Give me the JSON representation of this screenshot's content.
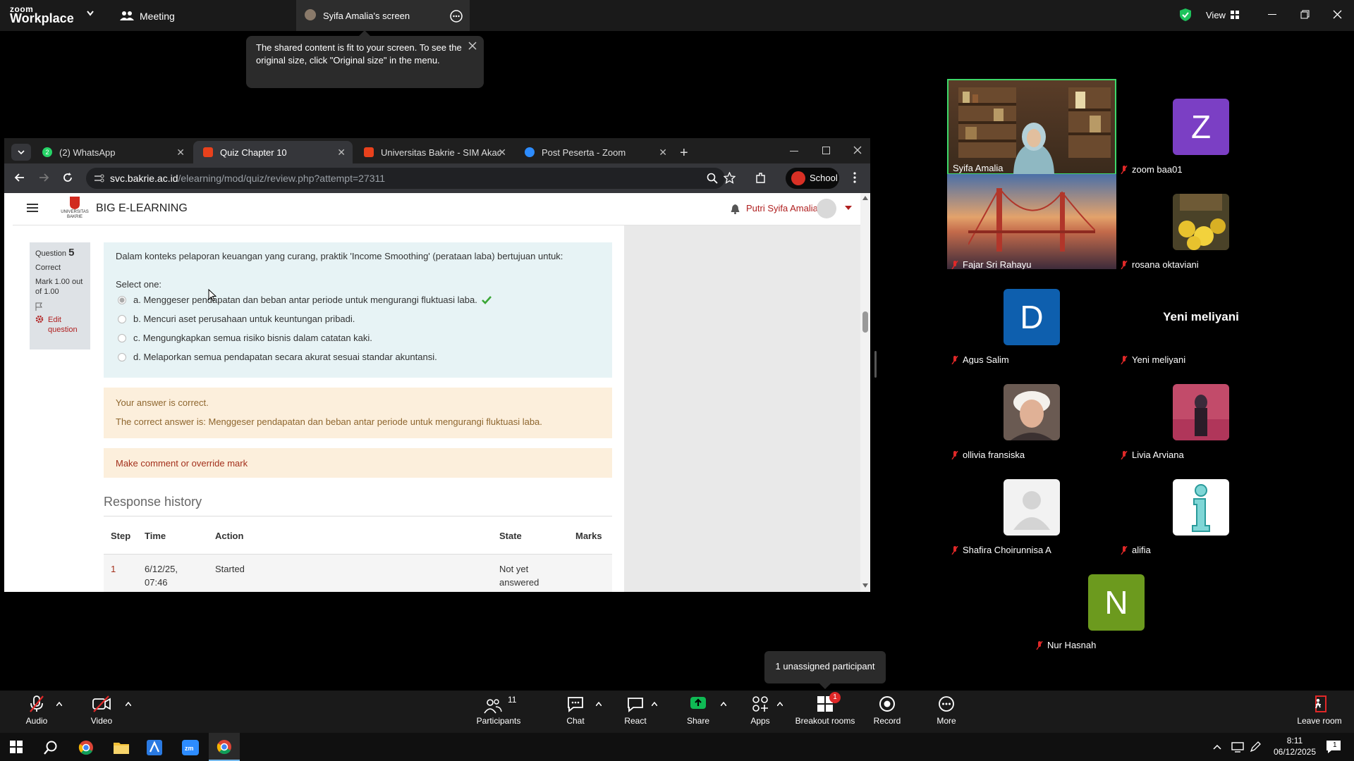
{
  "zoom": {
    "logo_line1": "zoom",
    "logo_line2": "Workplace",
    "meeting_label": "Meeting",
    "share_title": "Syifa Amalia's screen",
    "view_label": "View"
  },
  "tooltip": {
    "text": "The shared content is fit to your screen. To see the original size, click \"Original size\" in the menu."
  },
  "browser": {
    "tabs": [
      {
        "label": "(2) WhatsApp",
        "badge": "2"
      },
      {
        "label": "Quiz Chapter 10"
      },
      {
        "label": "Universitas Bakrie - SIM Akade"
      },
      {
        "label": "Post Peserta - Zoom"
      }
    ],
    "url_host": "svc.bakrie.ac.id",
    "url_path": "/elearning/mod/quiz/review.php?attempt=27311",
    "profile_label": "School"
  },
  "moodle": {
    "site_title": "BIG E-LEARNING",
    "logo_text": "UNIVERSITAS BAKRIE",
    "user_name": "Putri Syifa Amalia",
    "question": {
      "label": "Question",
      "number": "5",
      "status": "Correct",
      "mark": "Mark 1.00 out of 1.00",
      "edit": "Edit question",
      "text": "Dalam konteks pelaporan keuangan yang curang, praktik 'Income Smoothing' (perataan laba) bertujuan untuk:",
      "select_one": "Select one:",
      "options": [
        "a. Menggeser pendapatan dan beban antar periode untuk mengurangi fluktuasi laba.",
        "b. Mencuri aset perusahaan untuk keuntungan pribadi.",
        "c. Mengungkapkan semua risiko bisnis dalam catatan kaki.",
        "d. Melaporkan semua pendapatan secara akurat sesuai standar akuntansi."
      ],
      "selected_index": 0
    },
    "feedback": {
      "correct": "Your answer is correct.",
      "answer": "The correct answer is: Menggeser pendapatan dan beban antar periode untuk mengurangi fluktuasi laba."
    },
    "comment_link": "Make comment or override mark",
    "history": {
      "title": "Response history",
      "headers": [
        "Step",
        "Time",
        "Action",
        "State",
        "Marks"
      ],
      "rows": [
        {
          "step": "1",
          "time_line1": "6/12/25,",
          "time_line2": "07:46",
          "action": "Started",
          "state_line1": "Not yet",
          "state_line2": "answered",
          "marks": ""
        }
      ]
    }
  },
  "participants": [
    {
      "name": "Syifa Amalia",
      "type": "video",
      "muted": false,
      "active": true
    },
    {
      "name": "zoom baa01",
      "type": "letter",
      "letter": "Z",
      "color": "#7b3fc4",
      "muted": true
    },
    {
      "name": "Fajar Sri Rahayu",
      "type": "image-bridge",
      "muted": true
    },
    {
      "name": "rosana oktaviani",
      "type": "image-flowers",
      "muted": true
    },
    {
      "name": "Agus Salim",
      "type": "letter",
      "letter": "D",
      "color": "#0e5fae",
      "muted": true
    },
    {
      "name": "Yeni meliyani",
      "type": "name-only",
      "muted": true
    },
    {
      "name": "ollivia fransiska",
      "type": "photo",
      "muted": true
    },
    {
      "name": "Livia Arviana",
      "type": "photo2",
      "muted": true
    },
    {
      "name": "Shafira Choirunnisa A",
      "type": "default",
      "muted": true
    },
    {
      "name": "alifia",
      "type": "info",
      "muted": true
    },
    {
      "name": "Nur Hasnah",
      "type": "letter",
      "letter": "N",
      "color": "#6c9a1e",
      "muted": true
    }
  ],
  "unassigned_note": "1 unassigned participant",
  "toolbar": {
    "audio": "Audio",
    "video": "Video",
    "participants": "Participants",
    "participants_count": "11",
    "chat": "Chat",
    "react": "React",
    "share": "Share",
    "apps": "Apps",
    "breakout": "Breakout rooms",
    "breakout_badge": "1",
    "record": "Record",
    "more": "More",
    "leave": "Leave room"
  },
  "taskbar": {
    "time": "8:11",
    "date": "06/12/2025",
    "notif_count": "1"
  },
  "colors": {
    "zoom_bg": "#1a1a1a",
    "active_speaker": "#3ed86a",
    "share_green": "#0fb954",
    "correct_check": "#3aa635",
    "feedback_text": "#8e662e"
  }
}
